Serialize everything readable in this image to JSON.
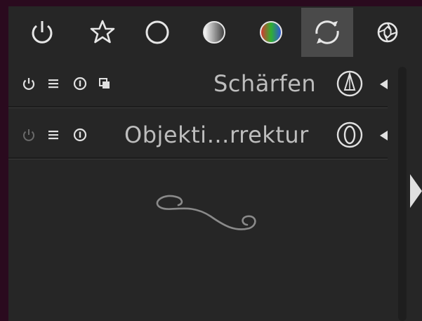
{
  "tabs": [
    {
      "icon": "power-icon",
      "active": false
    },
    {
      "icon": "star-icon",
      "active": false
    },
    {
      "icon": "circle-icon",
      "active": false
    },
    {
      "icon": "gradient-sphere-icon",
      "active": false
    },
    {
      "icon": "color-sphere-icon",
      "active": false
    },
    {
      "icon": "refresh-icon",
      "active": true
    },
    {
      "icon": "aperture-icon",
      "active": false
    }
  ],
  "modules": [
    {
      "title": "Schärfen",
      "icons": [
        "power-icon",
        "menu-icon",
        "info-icon",
        "copy-icon"
      ],
      "enabled": true
    },
    {
      "title": "Objekti…rrektur",
      "icons": [
        "power-icon",
        "menu-icon",
        "info-icon"
      ],
      "enabled": false
    }
  ],
  "colors": {
    "background": "#2a0a1e",
    "panel": "#262626",
    "active_tab": "#4a4a4a",
    "text": "#bdbdbd"
  }
}
